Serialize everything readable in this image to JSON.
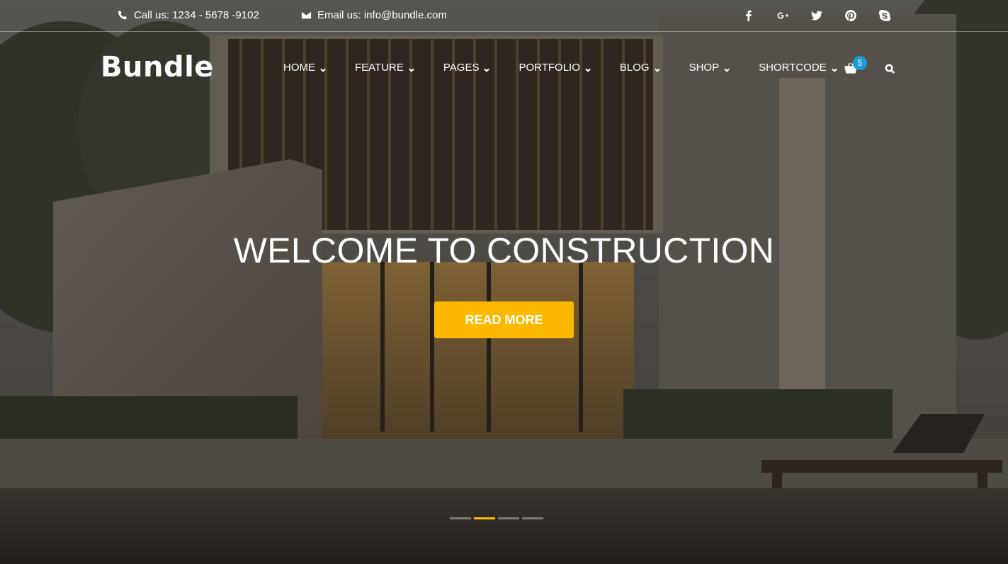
{
  "topbar": {
    "phone": "Call us: 1234 - 5678 -9102",
    "email": "Email us: info@bundle.com",
    "social": [
      {
        "name": "facebook-icon",
        "glyph": "f"
      },
      {
        "name": "google-plus-icon",
        "glyph": "G+"
      },
      {
        "name": "twitter-icon",
        "glyph": "twitter"
      },
      {
        "name": "pinterest-icon",
        "glyph": "pinterest"
      },
      {
        "name": "skype-icon",
        "glyph": "skype"
      }
    ]
  },
  "header": {
    "logo": "Bundle",
    "nav": [
      "HOME",
      "FEATURE",
      "PAGES",
      "PORTFOLIO",
      "BLOG",
      "SHOP",
      "SHORTCODE"
    ],
    "cart_count": "5"
  },
  "hero": {
    "headline": "WELCOME TO CONSTRUCTION",
    "cta_label": "READ MORE",
    "slides": 4,
    "active_slide": 2
  },
  "colors": {
    "accent": "#fcb900",
    "badge": "#1a9bd7"
  }
}
